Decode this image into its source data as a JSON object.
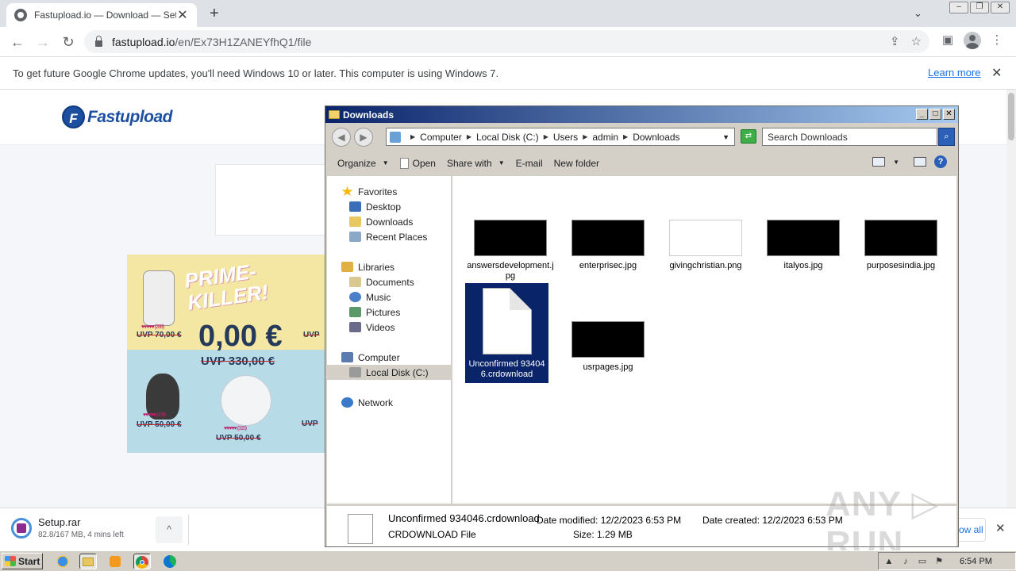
{
  "browser": {
    "tab_title": "Fastupload.io — Download — Setup.rar",
    "tab_close": "✕",
    "new_tab": "+",
    "tab_search": "⌄",
    "url_host": "fastupload.io",
    "url_path": "/en/Ex73H1ZANEYfhQ1/file",
    "nav_back": "←",
    "nav_forward": "→",
    "nav_reload": "↻",
    "share_glyph": "⇪",
    "star_glyph": "☆",
    "sidepanel_glyph": "▣",
    "menu_glyph": "⋮",
    "win_minimize": "–",
    "win_restore": "❐",
    "win_close": "✕"
  },
  "infobar": {
    "message": "To get future Google Chrome updates, you'll need Windows 10 or later. This computer is using Windows 7.",
    "link": "Learn more",
    "close": "✕"
  },
  "site": {
    "logo_letter": "F",
    "logo_text": "Fastupload"
  },
  "ad": {
    "headline_1": "PRIME-",
    "headline_2": "KILLER!",
    "price": "0,00 €",
    "uvp_main": "UVP 330,00 €",
    "uvp_left_top": "UVP 70,00 €",
    "uvp_left_bottom": "UVP 50,00 €",
    "uvp_center_bottom": "UVP 50,00 €",
    "uvp_right_top": "UVP",
    "uvp_right_bottom": "UVP",
    "stars_1": "♥♥♥♥♥ (289)",
    "stars_2": "♥♥♥♥♥ (209)",
    "stars_3": "♥♥♥♥♥ (315)"
  },
  "downloads": {
    "file_name": "Setup.rar",
    "status": "82.8/167 MB, 4 mins left",
    "chevron": "^",
    "show_all": "Show all",
    "close": "✕"
  },
  "explorer": {
    "title": "Downloads",
    "btn_min": "_",
    "btn_max": "□",
    "btn_close": "✕",
    "back": "◀",
    "forward": "▶",
    "breadcrumb": [
      "Computer",
      "Local Disk (C:)",
      "Users",
      "admin",
      "Downloads"
    ],
    "go_glyph": "⇄",
    "search_placeholder": "Search Downloads",
    "search_glyph": "⌕",
    "commands": {
      "organize": "Organize",
      "open": "Open",
      "share_with": "Share with",
      "email": "E-mail",
      "new_folder": "New folder",
      "help": "?"
    },
    "nav": {
      "favorites": "Favorites",
      "desktop": "Desktop",
      "downloads": "Downloads",
      "recent_places": "Recent Places",
      "libraries": "Libraries",
      "documents": "Documents",
      "music": "Music",
      "pictures": "Pictures",
      "videos": "Videos",
      "computer": "Computer",
      "local_disk": "Local Disk (C:)",
      "network": "Network"
    },
    "files": [
      {
        "name": "answersdevelopment.jpg",
        "type": "dark"
      },
      {
        "name": "enterprisec.jpg",
        "type": "dark"
      },
      {
        "name": "givingchristian.png",
        "type": "light"
      },
      {
        "name": "italyos.jpg",
        "type": "dark"
      },
      {
        "name": "purposesindia.jpg",
        "type": "dark"
      },
      {
        "name": "Unconfirmed 934046.crdownload",
        "type": "doc"
      },
      {
        "name": "usrpages.jpg",
        "type": "dark"
      }
    ],
    "details": {
      "name": "Unconfirmed 934046.crdownload",
      "type": "CRDOWNLOAD File",
      "modified": "Date modified: 12/2/2023 6:53 PM",
      "size": "Size: 1.29 MB",
      "created": "Date created: 12/2/2023 6:53 PM"
    }
  },
  "watermark": "ANY ▷ RUN",
  "taskbar": {
    "start": "Start",
    "time": "6:54 PM",
    "tray_up": "▲",
    "tray_volume": "♪",
    "tray_network": "▭",
    "tray_flag": "⚑"
  }
}
